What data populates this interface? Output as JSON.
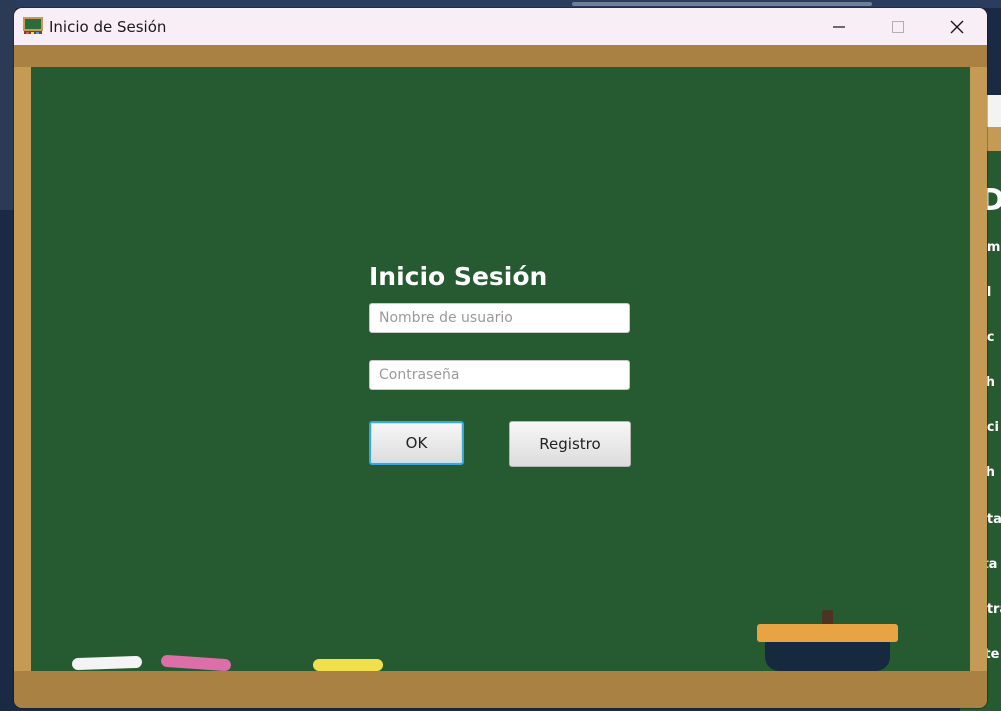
{
  "window": {
    "title": "Inicio de Sesión",
    "icon": "chalkboard-icon"
  },
  "titlebar_controls": {
    "minimize": "minimize-icon",
    "maximize": "maximize-icon",
    "close": "close-icon"
  },
  "login": {
    "title": "Inicio Sesión",
    "username_placeholder": "Nombre de usuario",
    "username_value": "",
    "password_placeholder": "Contraseña",
    "password_value": "",
    "ok_label": "OK",
    "register_label": "Registro"
  },
  "background_window": {
    "title_fragment": "D",
    "items": [
      "om",
      "el",
      "ac",
      "ch",
      "aci",
      "ch",
      "ota",
      "lta",
      "etra",
      "rte"
    ]
  },
  "colors": {
    "board": "#265a31",
    "frame": "#c59a55",
    "frame_dark": "#a98143",
    "titlebar": "#f8eef6",
    "ok_focus": "#3aa7d8",
    "chalk_white": "#f4f4f4",
    "chalk_pink": "#dc6fa8",
    "chalk_yellow": "#f1df4e",
    "eraser_top": "#e8a344",
    "eraser_body": "#17293f"
  }
}
